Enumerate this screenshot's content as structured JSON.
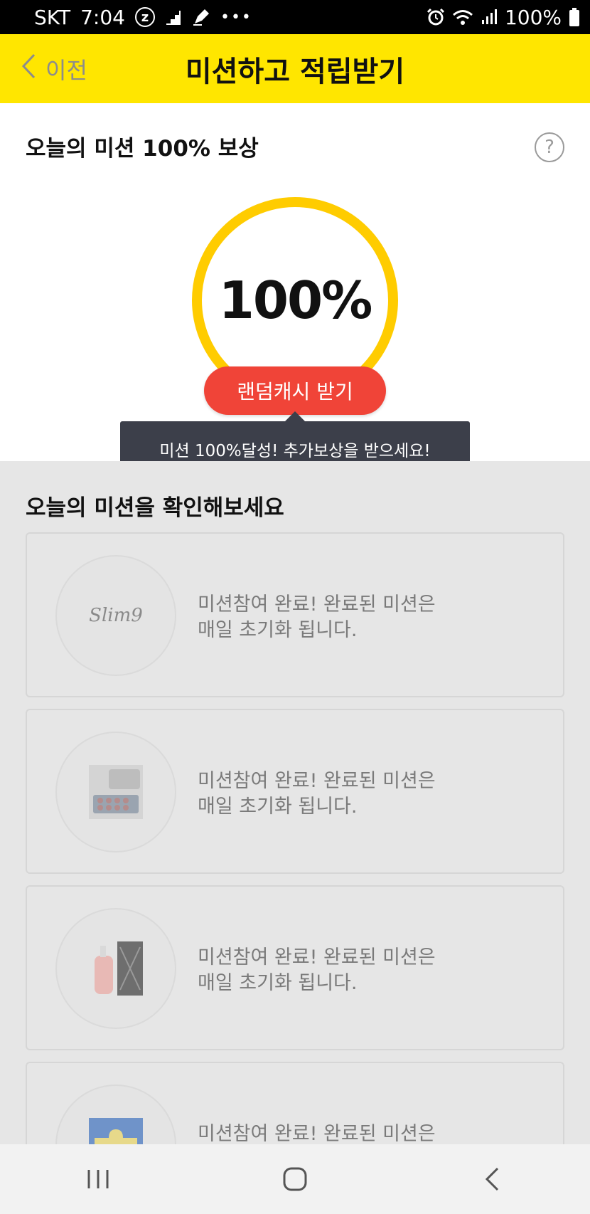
{
  "status_bar": {
    "carrier": "SKT",
    "time": "7:04",
    "battery": "100%",
    "icons": [
      "z-icon",
      "stairs-icon",
      "pen-icon",
      "more-dots-icon",
      "alarm-icon",
      "wifi-icon",
      "signal-icon",
      "battery-icon"
    ]
  },
  "header": {
    "back_label": "이전",
    "title": "미션하고 적립받기",
    "background": "#ffe600"
  },
  "reward": {
    "title": "오늘의 미션 100% 보상",
    "percent": "100%",
    "progress": 1.0,
    "button_label": "랜덤캐시 받기",
    "tooltip": "미션 100%달성! 추가보상을 받으세요!",
    "ring_color": "#ffcc00",
    "button_color": "#f04438"
  },
  "missions": {
    "title": "오늘의 미션을 확인해보세요",
    "items": [
      {
        "thumb_text": "Slim9",
        "line1": "미션참여 완료!  완료된 미션은",
        "line2": "매일 초기화 됩니다."
      },
      {
        "thumb_text": "",
        "line1": "미션참여 완료!  완료된 미션은",
        "line2": "매일 초기화 됩니다."
      },
      {
        "thumb_text": "",
        "line1": "미션참여 완료!  완료된 미션은",
        "line2": "매일 초기화 됩니다."
      },
      {
        "thumb_text": "",
        "line1": "미션참여 완료!  완료된 미션은",
        "line2": ""
      }
    ]
  },
  "nav": {
    "icons": [
      "recent-apps-icon",
      "home-icon",
      "back-icon"
    ]
  }
}
